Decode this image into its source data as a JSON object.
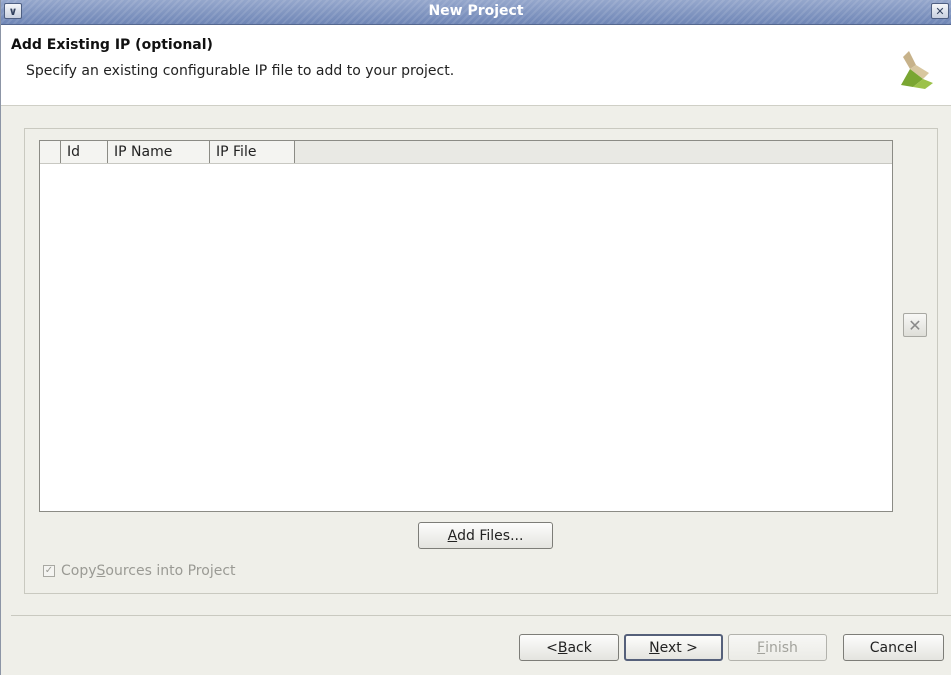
{
  "window": {
    "title": "New Project",
    "menu_icon": "chevron-down-icon",
    "close_icon": "close-icon"
  },
  "header": {
    "title": "Add Existing IP (optional)",
    "subtitle": "Specify an existing configurable IP file to add to your project.",
    "logo_icon": "xilinx-logo"
  },
  "table": {
    "columns": [
      "",
      "Id",
      "IP Name",
      "IP File"
    ],
    "rows": []
  },
  "buttons": {
    "add_files_pre": "",
    "add_files_mnemonic": "A",
    "add_files_post": "dd Files...",
    "back_pre": "< ",
    "back_mnemonic": "B",
    "back_post": "ack",
    "next_mnemonic": "N",
    "next_post": "ext >",
    "finish_mnemonic": "F",
    "finish_post": "inish",
    "cancel": "Cancel"
  },
  "copy_sources": {
    "pre": "Copy ",
    "mnemonic": "S",
    "post": "ources into Project",
    "checked": true,
    "enabled": false
  },
  "colors": {
    "titlebar": "#7f93bd",
    "background": "#efefe9",
    "disabled_text": "#9a9a94"
  }
}
